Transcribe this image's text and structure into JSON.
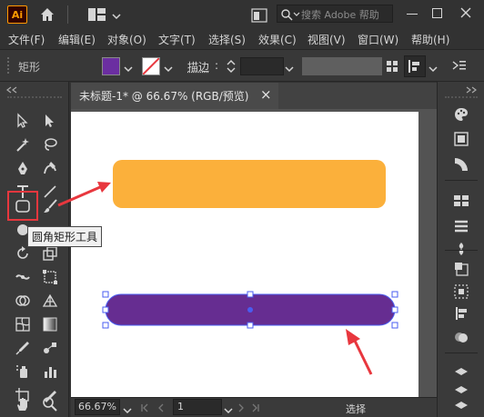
{
  "app": {
    "logo_text": "Ai",
    "search_placeholder": "搜索 Adobe 帮助"
  },
  "menu": [
    "文件(F)",
    "编辑(E)",
    "对象(O)",
    "文字(T)",
    "选择(S)",
    "效果(C)",
    "视图(V)",
    "窗口(W)",
    "帮助(H)"
  ],
  "control_bar": {
    "object_label": "矩形",
    "fill_color": "#6a2fa0",
    "stroke_label": "描边",
    "stroke_sep": ":",
    "fill_swatch_color": "#6b2ea1"
  },
  "document": {
    "tab_title": "未标题-1* @ 66.67% (RGB/预览)",
    "close_glyph": "×"
  },
  "tooltip": {
    "text": "圆角矩形工具"
  },
  "shapes": {
    "orange_rect_color": "#fbb03b",
    "purple_rect_color": "#662d91",
    "selection_color": "#4a5df0",
    "arrow_color": "#e8373e",
    "highlight_color": "#e8373e"
  },
  "status": {
    "zoom": "66.67%",
    "page": "1",
    "info": "选择"
  }
}
